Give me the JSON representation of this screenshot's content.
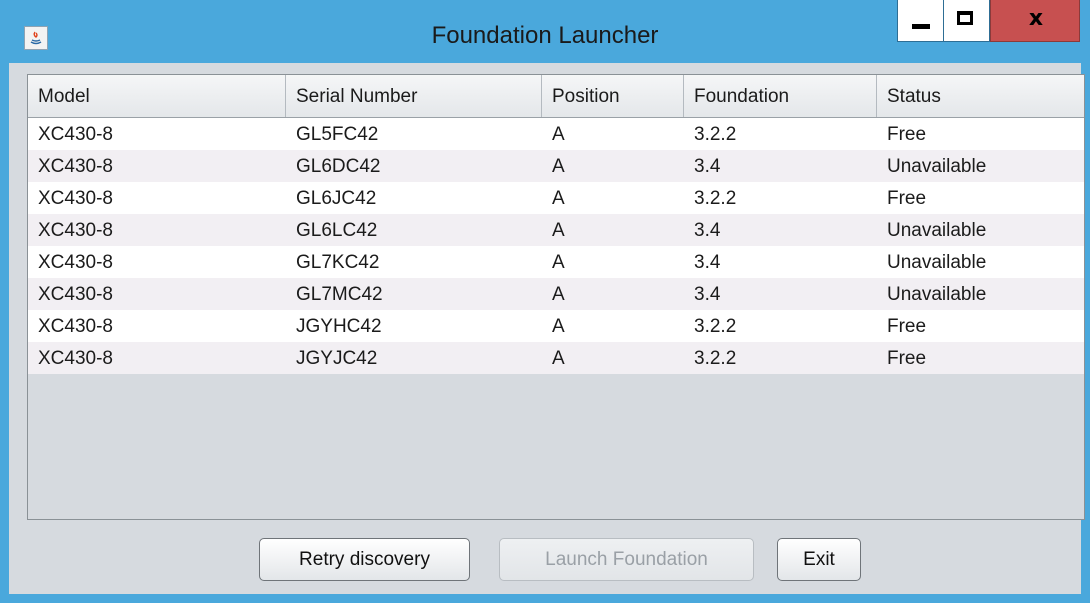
{
  "window": {
    "title": "Foundation Launcher",
    "icon": "java-icon",
    "controls": {
      "minimize": "minimize-icon",
      "maximize": "maximize-icon",
      "close_label": "x"
    }
  },
  "table": {
    "columns": [
      "Model",
      "Serial Number",
      "Position",
      "Foundation",
      "Status"
    ],
    "rows": [
      [
        "XC430-8",
        "GL5FC42",
        "A",
        "3.2.2",
        "Free"
      ],
      [
        "XC430-8",
        "GL6DC42",
        "A",
        "3.4",
        "Unavailable"
      ],
      [
        "XC430-8",
        "GL6JC42",
        "A",
        "3.2.2",
        "Free"
      ],
      [
        "XC430-8",
        "GL6LC42",
        "A",
        "3.4",
        "Unavailable"
      ],
      [
        "XC430-8",
        "GL7KC42",
        "A",
        "3.4",
        "Unavailable"
      ],
      [
        "XC430-8",
        "GL7MC42",
        "A",
        "3.4",
        "Unavailable"
      ],
      [
        "XC430-8",
        "JGYHC42",
        "A",
        "3.2.2",
        "Free"
      ],
      [
        "XC430-8",
        "JGYJC42",
        "A",
        "3.2.2",
        "Free"
      ]
    ]
  },
  "buttons": {
    "retry": "Retry discovery",
    "launch": "Launch Foundation",
    "exit": "Exit"
  },
  "colors": {
    "titlebar": "#4aa8dc",
    "close_button": "#c75050",
    "client_background": "#d6dadf",
    "row_alt": "#f2eff3"
  }
}
